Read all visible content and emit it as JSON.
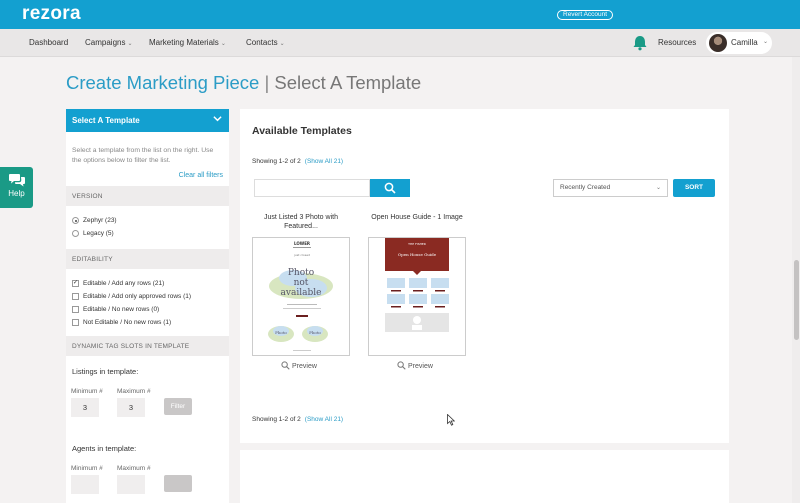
{
  "app": {
    "logo": "rezora",
    "revert_label": "Revert Account"
  },
  "nav": {
    "items": [
      "Dashboard",
      "Campaigns",
      "Marketing Materials",
      "Contacts"
    ],
    "resources": "Resources",
    "user_name": "Camilla"
  },
  "page": {
    "title_main": "Create Marketing Piece",
    "title_sep": "|",
    "title_sub": "Select A Template"
  },
  "help": {
    "label": "Help"
  },
  "sidebar": {
    "header": "Select A Template",
    "description": "Select a template from the list on the right. Use the options below to filter the list.",
    "clear_filters": "Clear all filters",
    "version": {
      "heading": "VERSION",
      "options": [
        {
          "label": "Zephyr (23)",
          "selected": true
        },
        {
          "label": "Legacy (5)",
          "selected": false
        }
      ]
    },
    "editability": {
      "heading": "EDITABILITY",
      "options": [
        {
          "label": "Editable / Add any rows (21)",
          "checked": true
        },
        {
          "label": "Editable / Add only approved rows (1)",
          "checked": false
        },
        {
          "label": "Editable / No new rows (0)",
          "checked": false
        },
        {
          "label": "Not Editable / No new rows (1)",
          "checked": false
        }
      ]
    },
    "dynamic_slots": {
      "heading": "DYNAMIC TAG SLOTS IN TEMPLATE",
      "listings_label": "Listings in template:",
      "agents_label": "Agents in template:",
      "min_label": "Minimum #",
      "max_label": "Maximum #",
      "listings_min": "3",
      "listings_max": "3",
      "filter_label": "Filter"
    }
  },
  "main": {
    "title": "Available Templates",
    "showing_top": "Showing 1-2 of 2",
    "showing_bottom": "Showing 1-2 of 2",
    "show_all": "(Show All 21)",
    "sort_value": "Recently Created",
    "sort_button": "SORT",
    "templates": [
      {
        "name": "Just Listed 3 Photo with Featured...",
        "preview": "Preview"
      },
      {
        "name": "Open House Guide - 1 Image",
        "preview": "Preview"
      }
    ],
    "thumb_text": {
      "logo": "LOWER",
      "subtitle": "just closed",
      "photo_na_1": "Photo",
      "photo_na_2": "not",
      "photo_na_3": "available",
      "oh_header": "THE FISHER",
      "oh_title": "Open House Guide"
    }
  },
  "colors": {
    "brand": "#13a0d0",
    "help_tab": "#1a9a86",
    "title_blue": "#2b9cc6"
  },
  "icons": [
    "search-icon",
    "chevron-down-icon",
    "bell-icon",
    "chat-icon",
    "magnifier-icon"
  ]
}
